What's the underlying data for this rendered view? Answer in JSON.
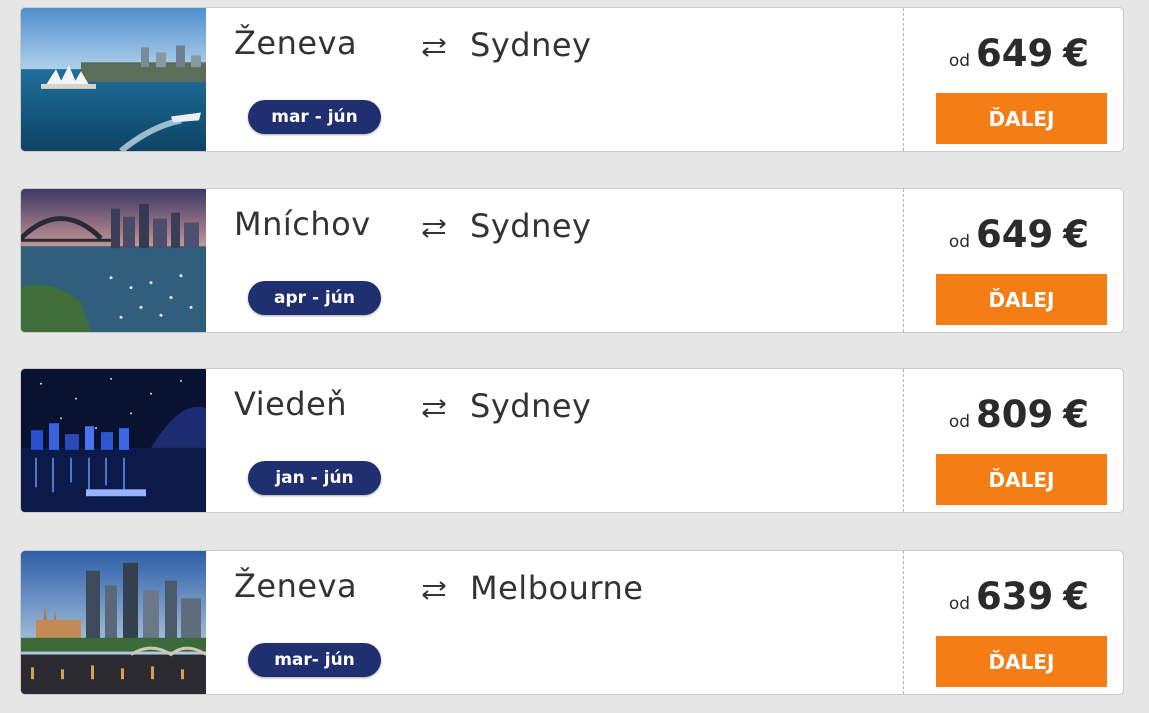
{
  "offers": [
    {
      "origin": "Ženeva",
      "destination": "Sydney",
      "period": "mar - jún",
      "price_prefix": "od",
      "price": "649",
      "currency": "€",
      "button_label": "ĎALEJ"
    },
    {
      "origin": "Mníchov",
      "destination": "Sydney",
      "period": "apr - jún",
      "price_prefix": "od",
      "price": "649",
      "currency": "€",
      "button_label": "ĎALEJ"
    },
    {
      "origin": "Viedeň",
      "destination": "Sydney",
      "period": "jan - jún",
      "price_prefix": "od",
      "price": "809",
      "currency": "€",
      "button_label": "ĎALEJ"
    },
    {
      "origin": "Ženeva",
      "destination": "Melbourne",
      "period": "mar- jún",
      "price_prefix": "od",
      "price": "639",
      "currency": "€",
      "button_label": "ĎALEJ"
    }
  ],
  "icons": {
    "swap": "swap-arrows-icon"
  },
  "colors": {
    "accent": "#f57d15",
    "badge": "#1f2f70",
    "background": "#e6e6e6"
  }
}
